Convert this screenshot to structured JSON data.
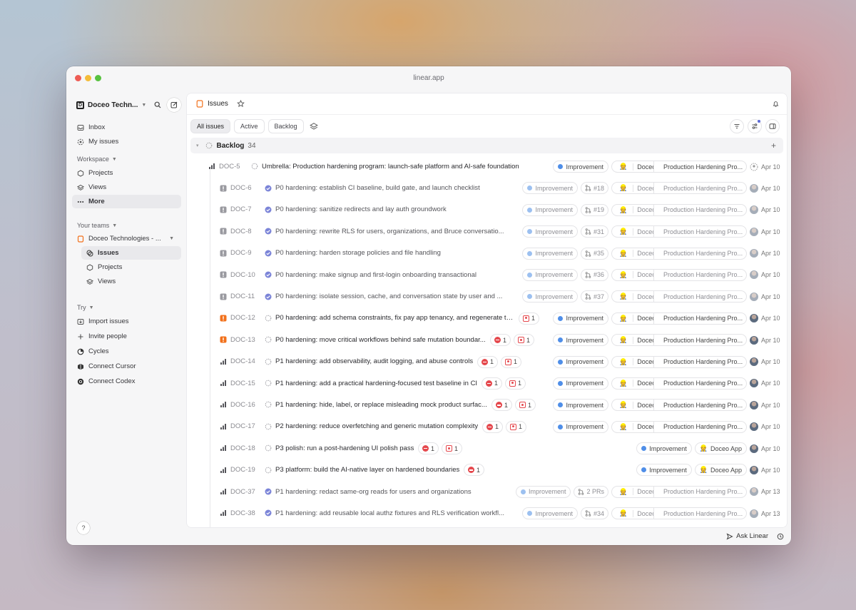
{
  "window": {
    "title": "linear.app"
  },
  "sidebar": {
    "workspace": "Doceo Techn...",
    "top_items": [
      {
        "label": "Inbox",
        "icon": "inbox-icon"
      },
      {
        "label": "My issues",
        "icon": "my-issues-icon"
      }
    ],
    "workspace_section": "Workspace",
    "workspace_items": [
      {
        "label": "Projects",
        "icon": "projects-icon"
      },
      {
        "label": "Views",
        "icon": "views-icon"
      },
      {
        "label": "More",
        "icon": "more-icon"
      }
    ],
    "teams_section": "Your teams",
    "team_name": "Doceo Technologies - ...",
    "team_items": [
      {
        "label": "Issues",
        "icon": "issues-icon"
      },
      {
        "label": "Projects",
        "icon": "projects-icon"
      },
      {
        "label": "Views",
        "icon": "views-icon"
      }
    ],
    "try_section": "Try",
    "try_items": [
      {
        "label": "Import issues",
        "icon": "import-icon"
      },
      {
        "label": "Invite people",
        "icon": "plus-icon"
      },
      {
        "label": "Cycles",
        "icon": "cycles-icon"
      },
      {
        "label": "Connect Cursor",
        "icon": "cursor-icon"
      },
      {
        "label": "Connect Codex",
        "icon": "codex-icon"
      }
    ],
    "help": "?"
  },
  "header": {
    "title": "Issues"
  },
  "tabs": [
    "All issues",
    "Active",
    "Backlog"
  ],
  "group": {
    "name": "Backlog",
    "count": "34"
  },
  "issues": [
    {
      "id": "DOC-5",
      "title": "Umbrella: Production hardening program: launch-safe platform and AI-safe foundation",
      "label": "Improvement",
      "team": "Doceo ...",
      "project": "Production Hardening Pro...",
      "date": "Apr 10"
    },
    {
      "id": "DOC-6",
      "title": "P0 hardening: establish CI baseline, build gate, and launch checklist",
      "label": "Improvement",
      "pr": "#18",
      "team": "Doceo ...",
      "project": "Production Hardening Pro...",
      "date": "Apr 10"
    },
    {
      "id": "DOC-7",
      "title": "P0 hardening: sanitize redirects and lay auth groundwork",
      "label": "Improvement",
      "pr": "#19",
      "team": "Doceo ...",
      "project": "Production Hardening Pro...",
      "date": "Apr 10"
    },
    {
      "id": "DOC-8",
      "title": "P0 hardening: rewrite RLS for users, organizations, and Bruce conversatio...",
      "label": "Improvement",
      "pr": "#31",
      "team": "Doceo ...",
      "project": "Production Hardening Pro...",
      "date": "Apr 10"
    },
    {
      "id": "DOC-9",
      "title": "P0 hardening: harden storage policies and file handling",
      "label": "Improvement",
      "pr": "#35",
      "team": "Doceo ...",
      "project": "Production Hardening Pro...",
      "date": "Apr 10"
    },
    {
      "id": "DOC-10",
      "title": "P0 hardening: make signup and first-login onboarding transactional",
      "label": "Improvement",
      "pr": "#36",
      "team": "Doceo ...",
      "project": "Production Hardening Pro...",
      "date": "Apr 10"
    },
    {
      "id": "DOC-11",
      "title": "P0 hardening: isolate session, cache, and conversation state by user and ...",
      "label": "Improvement",
      "pr": "#37",
      "team": "Doceo ...",
      "project": "Production Hardening Pro...",
      "date": "Apr 10"
    },
    {
      "id": "DOC-12",
      "title": "P0 hardening: add schema constraints, fix pay app tenancy, and regenerate ty...",
      "blocked": "1",
      "label": "Improvement",
      "team": "Doceo ...",
      "project": "Production Hardening Pro...",
      "date": "Apr 10"
    },
    {
      "id": "DOC-13",
      "title": "P0 hardening: move critical workflows behind safe mutation boundar...",
      "blocking": "1",
      "blocked": "1",
      "label": "Improvement",
      "team": "Doceo ...",
      "project": "Production Hardening Pro...",
      "date": "Apr 10"
    },
    {
      "id": "DOC-14",
      "title": "P1 hardening: add observability, audit logging, and abuse controls",
      "blocking": "1",
      "blocked": "1",
      "label": "Improvement",
      "team": "Doceo ...",
      "project": "Production Hardening Pro...",
      "date": "Apr 10"
    },
    {
      "id": "DOC-15",
      "title": "P1 hardening: add a practical hardening-focused test baseline in CI",
      "blocking": "1",
      "blocked": "1",
      "label": "Improvement",
      "team": "Doceo ...",
      "project": "Production Hardening Pro...",
      "date": "Apr 10"
    },
    {
      "id": "DOC-16",
      "title": "P1 hardening: hide, label, or replace misleading mock product surfac...",
      "blocking": "1",
      "blocked": "1",
      "label": "Improvement",
      "team": "Doceo ...",
      "project": "Production Hardening Pro...",
      "date": "Apr 10"
    },
    {
      "id": "DOC-17",
      "title": "P2 hardening: reduce overfetching and generic mutation complexity",
      "blocking": "1",
      "blocked": "1",
      "label": "Improvement",
      "team": "Doceo ...",
      "project": "Production Hardening Pro...",
      "date": "Apr 10"
    },
    {
      "id": "DOC-18",
      "title": "P3 polish: run a post-hardening UI polish pass",
      "blocking": "1",
      "blocked": "1",
      "label": "Improvement",
      "team": "Doceo App",
      "date": "Apr 10"
    },
    {
      "id": "DOC-19",
      "title": "P3 platform: build the AI-native layer on hardened boundaries",
      "blocking": "1",
      "label": "Improvement",
      "team": "Doceo App",
      "date": "Apr 10"
    },
    {
      "id": "DOC-37",
      "title": "P1 hardening: redact same-org reads for users and organizations",
      "label": "Improvement",
      "pr": "2 PRs",
      "team": "Doceo ...",
      "project": "Production Hardening Pro...",
      "date": "Apr 13"
    },
    {
      "id": "DOC-38",
      "title": "P1 hardening: add reusable local authz fixtures and RLS verification workfl...",
      "label": "Improvement",
      "pr": "#34",
      "team": "Doceo ...",
      "project": "Production Hardening Pro...",
      "date": "Apr 13"
    }
  ],
  "footer": {
    "ask": "Ask Linear"
  },
  "colors": {
    "accent": "#5e6ad2",
    "urgent": "#f2711c",
    "blocked": "#e5484d",
    "label": "#4f8ee8"
  }
}
